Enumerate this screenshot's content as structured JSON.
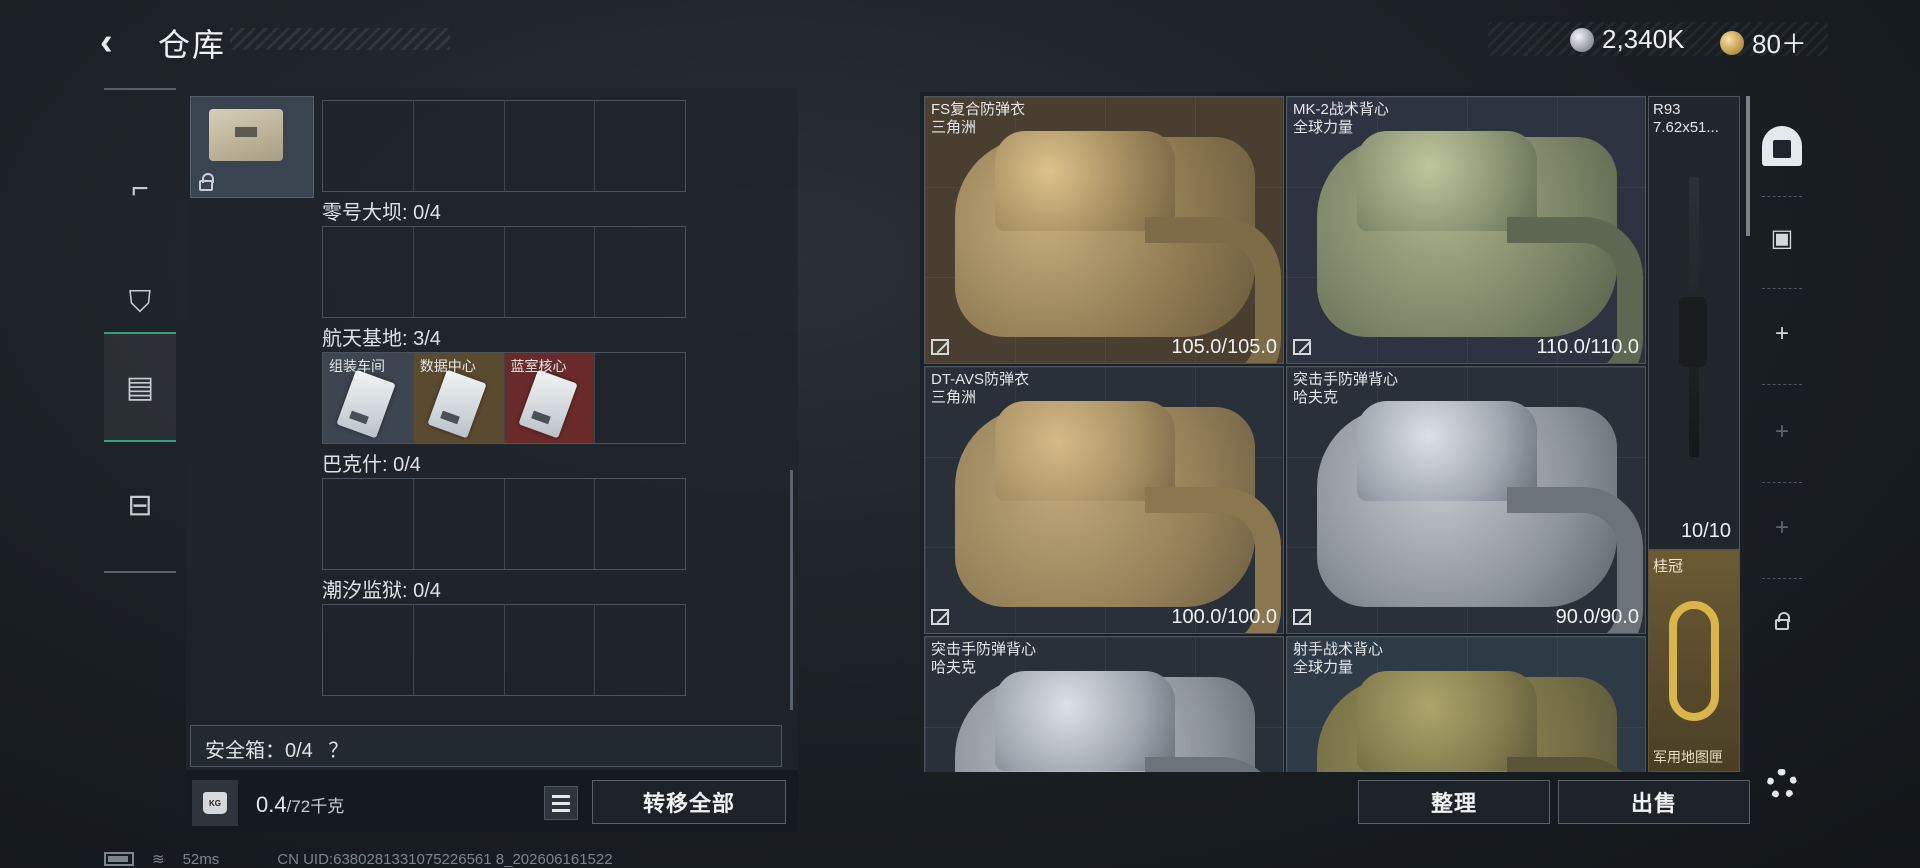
{
  "header": {
    "title": "仓库",
    "currency": [
      {
        "icon": "silver-coin-icon",
        "value": "2,340K"
      },
      {
        "icon": "gold-coin-icon",
        "value": "80＋"
      }
    ]
  },
  "nav": {
    "items": [
      {
        "name": "weapons",
        "icon": "pistol-icon",
        "active": false
      },
      {
        "name": "equipment",
        "icon": "chest-rig-icon",
        "active": false
      },
      {
        "name": "backpack",
        "icon": "backpack-icon",
        "active": true
      },
      {
        "name": "case",
        "icon": "toolbox-icon",
        "active": false
      }
    ]
  },
  "container": {
    "sections": [
      {
        "label": "零号大坝: 0/4",
        "slots": [
          "",
          "",
          "",
          ""
        ]
      },
      {
        "label": "航天基地: 3/4",
        "slots": [
          "组装车间",
          "数据中心",
          "蓝室核心",
          ""
        ]
      },
      {
        "label": "巴克什: 0/4",
        "slots": [
          "",
          "",
          "",
          ""
        ]
      },
      {
        "label": "潮汐监狱: 0/4",
        "slots": [
          "",
          "",
          "",
          ""
        ]
      }
    ],
    "safe_box_label": "安全箱：0/4",
    "safe_box_help": "？",
    "weight_value": "0.4",
    "weight_max": "/72千克",
    "transfer_all_label": "转移全部"
  },
  "storage": {
    "vests": [
      {
        "name": "FS复合防弹衣",
        "faction": "三角洲",
        "durability": "105.0/105.0",
        "color": "#8e7a52"
      },
      {
        "name": "MK-2战术背心",
        "faction": "全球力量",
        "durability": "110.0/110.0",
        "color": "#7b8466"
      },
      {
        "name": "DT-AVS防弹衣",
        "faction": "三角洲",
        "durability": "100.0/100.0",
        "color": "#958159"
      },
      {
        "name": "突击手防弹背心",
        "faction": "哈夫克",
        "durability": "90.0/90.0",
        "color": "#8e949c"
      },
      {
        "name": "突击手防弹背心",
        "faction": "哈夫克",
        "durability": "",
        "color": "#8e949c"
      },
      {
        "name": "射手战术背心",
        "faction": "全球力量",
        "durability": "",
        "color": "#766f46"
      }
    ],
    "rifle": {
      "name": "R93",
      "ammo": "7.62x51...",
      "count": "10/10"
    },
    "crown": {
      "name": "桂冠",
      "sub": "军用地图匣"
    },
    "sort_label": "整理",
    "sell_label": "出售"
  },
  "toolbar": {
    "add_1": "+",
    "add_2": "+",
    "add_3": "+"
  },
  "status": {
    "ping": "52ms",
    "uid": "CN UID:6380281331075226561 8_202606161522"
  }
}
